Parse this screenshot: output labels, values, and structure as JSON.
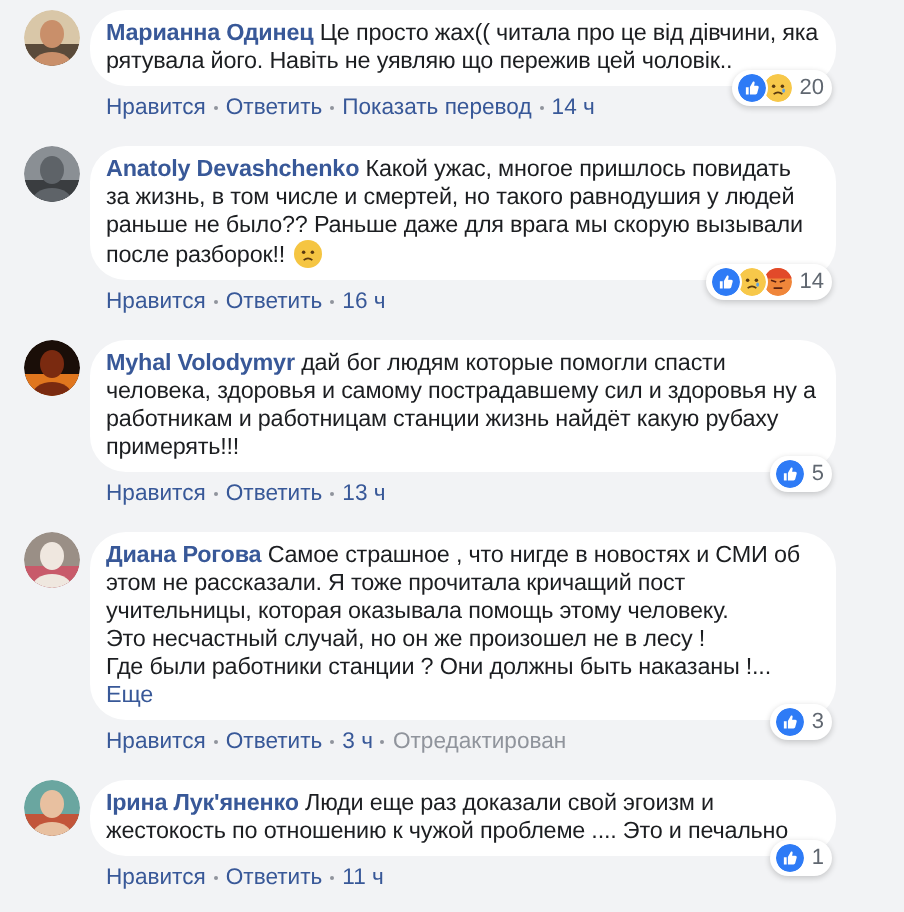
{
  "comments": [
    {
      "author": "Марианна Одинец",
      "text": "Це просто жах(( читала про це від дівчини, яка рятувала його. Навіть не уявляю що пережив цей чоловік..",
      "emoji": false,
      "actions": [
        {
          "label": "Нравится",
          "kind": "link"
        },
        {
          "label": "Ответить",
          "kind": "link"
        },
        {
          "label": "Показать перевод",
          "kind": "link"
        },
        {
          "label": "14 ч",
          "kind": "time"
        }
      ],
      "reactions": [
        {
          "kind": "like"
        },
        {
          "kind": "sad"
        }
      ],
      "count": "20"
    },
    {
      "author": "Anatoly Devashchenko",
      "text": "Какой ужас, многое пришлось повидать за жизнь, в том числе и смертей, но такого равнодушия у людей раньше не было?? Раньше даже для врага мы скорую вызывали после разборок!!",
      "emoji": true,
      "actions": [
        {
          "label": "Нравится",
          "kind": "link"
        },
        {
          "label": "Ответить",
          "kind": "link"
        },
        {
          "label": "16 ч",
          "kind": "time"
        }
      ],
      "reactions": [
        {
          "kind": "like"
        },
        {
          "kind": "sad"
        },
        {
          "kind": "angry"
        }
      ],
      "count": "14"
    },
    {
      "author": "Myhal Volodymyr",
      "text": "дай бог людям которые помогли спасти человека, здоровья и самому пострадавшему сил и здоровья ну а работникам и работницам станции жизнь найдёт какую рубаху примерять!!!",
      "emoji": false,
      "actions": [
        {
          "label": "Нравится",
          "kind": "link"
        },
        {
          "label": "Ответить",
          "kind": "link"
        },
        {
          "label": "13 ч",
          "kind": "time"
        }
      ],
      "reactions": [
        {
          "kind": "like"
        }
      ],
      "count": "5"
    },
    {
      "author": "Диана Рогова",
      "text": "Самое страшное , что нигде в новостях и СМИ об этом не рассказали. Я тоже прочитала кричащий пост учительницы, которая оказывала помощь этому человеку.\nЭто несчастный случай, но он же произошел не в лесу !\nГде были работники станции ? Они должны быть наказаны !...",
      "emoji": false,
      "more": "Еще",
      "actions": [
        {
          "label": "Нравится",
          "kind": "link"
        },
        {
          "label": "Ответить",
          "kind": "link"
        },
        {
          "label": "3 ч",
          "kind": "time"
        },
        {
          "label": "Отредактирован",
          "kind": "note"
        }
      ],
      "reactions": [
        {
          "kind": "like"
        }
      ],
      "count": "3"
    },
    {
      "author": "Ірина Лук'яненко",
      "text": "Люди еще раз доказали свой эгоизм и жестокость по отношению к чужой проблеме .... Это и печально",
      "emoji": false,
      "actions": [
        {
          "label": "Нравится",
          "kind": "link"
        },
        {
          "label": "Ответить",
          "kind": "link"
        },
        {
          "label": "11 ч",
          "kind": "time"
        }
      ],
      "reactions": [
        {
          "kind": "like"
        }
      ],
      "count": "1"
    }
  ]
}
